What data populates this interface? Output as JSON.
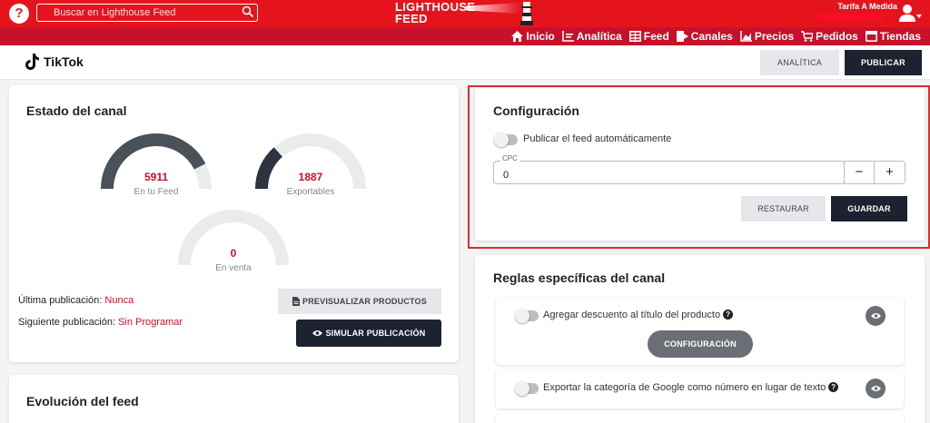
{
  "topbar": {
    "help_label": "?",
    "search_placeholder": "Buscar en Lighthouse Feed",
    "logo_text_line1": "LIGHTHOUSE",
    "logo_text_line2": "FEED",
    "plan_label": "Tarifa A Medida",
    "icons": {
      "search": "search-icon",
      "user": "user-icon",
      "dropdown": "caret-down-icon"
    }
  },
  "nav": {
    "items": [
      {
        "label": "Inicio",
        "icon": "home-icon"
      },
      {
        "label": "Analítica",
        "icon": "analytics-icon"
      },
      {
        "label": "Feed",
        "icon": "table-icon"
      },
      {
        "label": "Canales",
        "icon": "channels-icon"
      },
      {
        "label": "Precios",
        "icon": "chart-icon"
      },
      {
        "label": "Pedidos",
        "icon": "cart-icon"
      },
      {
        "label": "Tiendas",
        "icon": "store-icon"
      }
    ]
  },
  "header": {
    "brand": "TikTok",
    "analitica_label": "ANALÍTICA",
    "publicar_label": "PUBLICAR"
  },
  "estado": {
    "title": "Estado del canal",
    "gauges": [
      {
        "value": "5911",
        "label": "En tu Feed",
        "fill": 0.85
      },
      {
        "value": "1887",
        "label": "Exportables",
        "fill": 0.27
      },
      {
        "value": "0",
        "label": "En venta",
        "fill": 0
      }
    ],
    "ultima_label": "Última publicación:",
    "ultima_value": "Nunca",
    "siguiente_label": "Siguiente publicación:",
    "siguiente_value": "Sin Programar",
    "preview_label": "PREVISUALIZAR PRODUCTOS",
    "simular_label": "SIMULAR PUBLICACIÓN"
  },
  "evolucion": {
    "title": "Evolución del feed"
  },
  "config": {
    "title": "Configuración",
    "auto_publish_label": "Publicar el feed automáticamente",
    "auto_publish_on": false,
    "cpc_label": "CPC",
    "cpc_value": "0",
    "minus_label": "−",
    "plus_label": "+",
    "restaurar_label": "RESTAURAR",
    "guardar_label": "GUARDAR"
  },
  "reglas": {
    "title": "Reglas específicas del canal",
    "rules": [
      {
        "label": "Agregar descuento al título del producto",
        "enabled": false,
        "config_label": "CONFIGURACIÓN"
      },
      {
        "label": "Exportar la categoría de Google como número en lugar de texto",
        "enabled": false
      }
    ]
  },
  "colors": {
    "brand_red": "#e5141c",
    "nav_red": "#c8102a",
    "dark": "#1d2230",
    "value_red": "#c8102a"
  }
}
